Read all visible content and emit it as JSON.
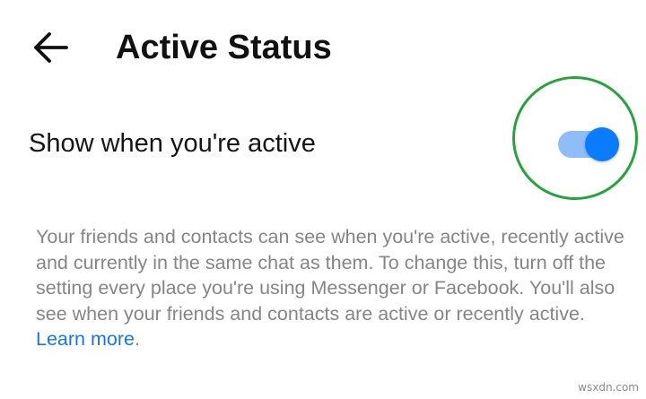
{
  "header": {
    "title": "Active Status",
    "back_icon": "arrow-left-icon"
  },
  "setting": {
    "label": "Show when you're active",
    "enabled": true,
    "track_color": "#8fbdf8",
    "knob_color": "#0a7cff"
  },
  "highlight": {
    "color": "#26a33b"
  },
  "description": {
    "text": "Your friends and contacts can see when you're active, recently active and currently in the same chat as them. To change this, turn off the setting every place you're using Messenger or Facebook. You'll also see when your friends and contacts are active or recently active. ",
    "link_label": "Learn more",
    "trailing": ".",
    "link_color": "#1a73e8"
  },
  "watermark": "wsxdn.com"
}
